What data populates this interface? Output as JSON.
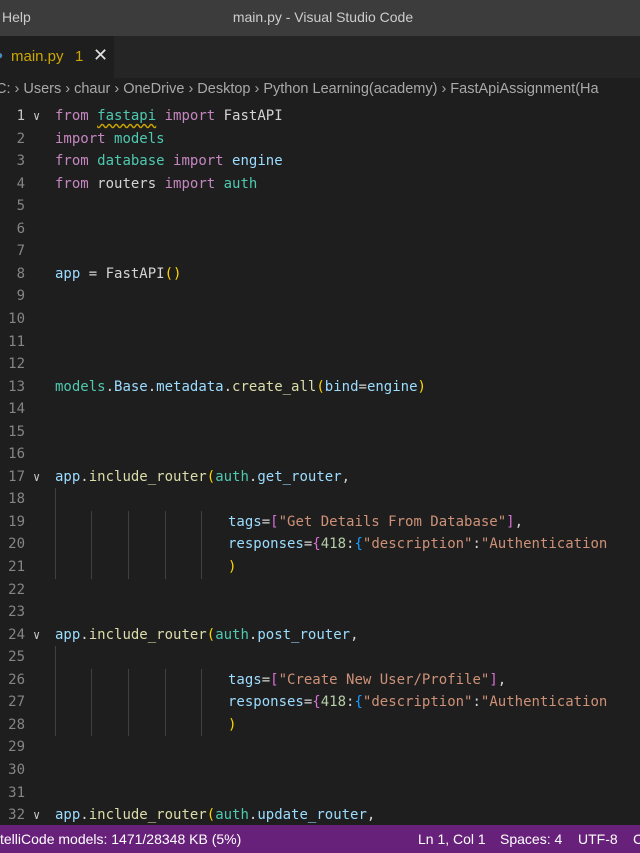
{
  "titlebar": {
    "menu_help": "Help",
    "window_title": "main.py - Visual Studio Code"
  },
  "tab": {
    "icon": "python-file-icon",
    "filename": "main.py",
    "problem_count": "1",
    "close_glyph": "✕"
  },
  "breadcrumb": {
    "items": [
      "C:",
      "Users",
      "chaur",
      "OneDrive",
      "Desktop",
      "Python Learning(academy)",
      "FastApiAssignment(Ha"
    ],
    "separator": "›"
  },
  "editor": {
    "fold_glyph": "∨",
    "active_line": 1,
    "lines": [
      {
        "n": "1",
        "fold": true,
        "tokens": [
          [
            "kw",
            "from"
          ],
          [
            "plain",
            " "
          ],
          [
            "mod squig",
            "fastapi"
          ],
          [
            "plain",
            " "
          ],
          [
            "kw",
            "import"
          ],
          [
            "plain",
            " "
          ],
          [
            "plain",
            "FastAPI"
          ]
        ]
      },
      {
        "n": "2",
        "tokens": [
          [
            "kw",
            "import"
          ],
          [
            "plain",
            " "
          ],
          [
            "mod",
            "models"
          ]
        ]
      },
      {
        "n": "3",
        "tokens": [
          [
            "kw",
            "from"
          ],
          [
            "plain",
            " "
          ],
          [
            "mod",
            "database"
          ],
          [
            "plain",
            " "
          ],
          [
            "kw",
            "import"
          ],
          [
            "plain",
            " "
          ],
          [
            "var",
            "engine"
          ]
        ]
      },
      {
        "n": "4",
        "tokens": [
          [
            "kw",
            "from"
          ],
          [
            "plain",
            " "
          ],
          [
            "plain",
            "routers"
          ],
          [
            "plain",
            " "
          ],
          [
            "kw",
            "import"
          ],
          [
            "plain",
            " "
          ],
          [
            "mod",
            "auth"
          ]
        ]
      },
      {
        "n": "5",
        "tokens": []
      },
      {
        "n": "6",
        "tokens": []
      },
      {
        "n": "7",
        "tokens": []
      },
      {
        "n": "8",
        "tokens": [
          [
            "var",
            "app"
          ],
          [
            "plain",
            " = "
          ],
          [
            "plain",
            "FastAPI"
          ],
          [
            "br1",
            "()"
          ]
        ]
      },
      {
        "n": "9",
        "tokens": []
      },
      {
        "n": "10",
        "tokens": []
      },
      {
        "n": "11",
        "tokens": []
      },
      {
        "n": "12",
        "tokens": []
      },
      {
        "n": "13",
        "tokens": [
          [
            "mod",
            "models"
          ],
          [
            "plain",
            "."
          ],
          [
            "var",
            "Base"
          ],
          [
            "plain",
            "."
          ],
          [
            "var",
            "metadata"
          ],
          [
            "plain",
            "."
          ],
          [
            "fn",
            "create_all"
          ],
          [
            "br1",
            "("
          ],
          [
            "var",
            "bind"
          ],
          [
            "plain",
            "="
          ],
          [
            "var",
            "engine"
          ],
          [
            "br1",
            ")"
          ]
        ]
      },
      {
        "n": "14",
        "tokens": []
      },
      {
        "n": "15",
        "tokens": []
      },
      {
        "n": "16",
        "tokens": []
      },
      {
        "n": "17",
        "fold": true,
        "tokens": [
          [
            "var",
            "app"
          ],
          [
            "plain",
            "."
          ],
          [
            "fn",
            "include_router"
          ],
          [
            "br1",
            "("
          ],
          [
            "mod",
            "auth"
          ],
          [
            "plain",
            "."
          ],
          [
            "var",
            "get_router"
          ],
          [
            "plain",
            ","
          ]
        ]
      },
      {
        "n": "18",
        "guides": 1,
        "tokens": []
      },
      {
        "n": "19",
        "guides": 5,
        "indent": true,
        "tokens": [
          [
            "var",
            "tags"
          ],
          [
            "plain",
            "="
          ],
          [
            "br2",
            "["
          ],
          [
            "str",
            "\"Get Details From Database\""
          ],
          [
            "br2",
            "]"
          ],
          [
            "plain",
            ","
          ]
        ]
      },
      {
        "n": "20",
        "guides": 5,
        "indent": true,
        "tokens": [
          [
            "var",
            "responses"
          ],
          [
            "plain",
            "="
          ],
          [
            "br2",
            "{"
          ],
          [
            "num",
            "418"
          ],
          [
            "plain",
            ":"
          ],
          [
            "br3",
            "{"
          ],
          [
            "str",
            "\"description\""
          ],
          [
            "plain",
            ":"
          ],
          [
            "str",
            "\"Authentication"
          ]
        ]
      },
      {
        "n": "21",
        "guides": 5,
        "indent": true,
        "tokens": [
          [
            "br1",
            ")"
          ]
        ]
      },
      {
        "n": "22",
        "tokens": []
      },
      {
        "n": "23",
        "tokens": []
      },
      {
        "n": "24",
        "fold": true,
        "tokens": [
          [
            "var",
            "app"
          ],
          [
            "plain",
            "."
          ],
          [
            "fn",
            "include_router"
          ],
          [
            "br1",
            "("
          ],
          [
            "mod",
            "auth"
          ],
          [
            "plain",
            "."
          ],
          [
            "var",
            "post_router"
          ],
          [
            "plain",
            ","
          ]
        ]
      },
      {
        "n": "25",
        "guides": 1,
        "tokens": []
      },
      {
        "n": "26",
        "guides": 5,
        "indent": true,
        "tokens": [
          [
            "var",
            "tags"
          ],
          [
            "plain",
            "="
          ],
          [
            "br2",
            "["
          ],
          [
            "str",
            "\"Create New User/Profile\""
          ],
          [
            "br2",
            "]"
          ],
          [
            "plain",
            ","
          ]
        ]
      },
      {
        "n": "27",
        "guides": 5,
        "indent": true,
        "tokens": [
          [
            "var",
            "responses"
          ],
          [
            "plain",
            "="
          ],
          [
            "br2",
            "{"
          ],
          [
            "num",
            "418"
          ],
          [
            "plain",
            ":"
          ],
          [
            "br3",
            "{"
          ],
          [
            "str",
            "\"description\""
          ],
          [
            "plain",
            ":"
          ],
          [
            "str",
            "\"Authentication"
          ]
        ]
      },
      {
        "n": "28",
        "guides": 5,
        "indent": true,
        "tokens": [
          [
            "br1",
            ")"
          ]
        ]
      },
      {
        "n": "29",
        "tokens": []
      },
      {
        "n": "30",
        "tokens": []
      },
      {
        "n": "31",
        "tokens": []
      },
      {
        "n": "32",
        "fold": true,
        "tokens": [
          [
            "var",
            "app"
          ],
          [
            "plain",
            "."
          ],
          [
            "fn",
            "include_router"
          ],
          [
            "br1",
            "("
          ],
          [
            "mod",
            "auth"
          ],
          [
            "plain",
            "."
          ],
          [
            "var",
            "update_router"
          ],
          [
            "plain",
            ","
          ]
        ]
      }
    ]
  },
  "statusbar": {
    "intellicode": "telliCode models: 1471/28348 KB (5%)",
    "cursor_position": "Ln 1, Col 1",
    "indentation": "Spaces: 4",
    "encoding": "UTF-8",
    "eol_partial": "C"
  },
  "colors": {
    "statusbar_bg": "#68217a",
    "editor_bg": "#1e1e1e",
    "titlebar_bg": "#3c3c3c",
    "tab_modified_color": "#cca700"
  }
}
